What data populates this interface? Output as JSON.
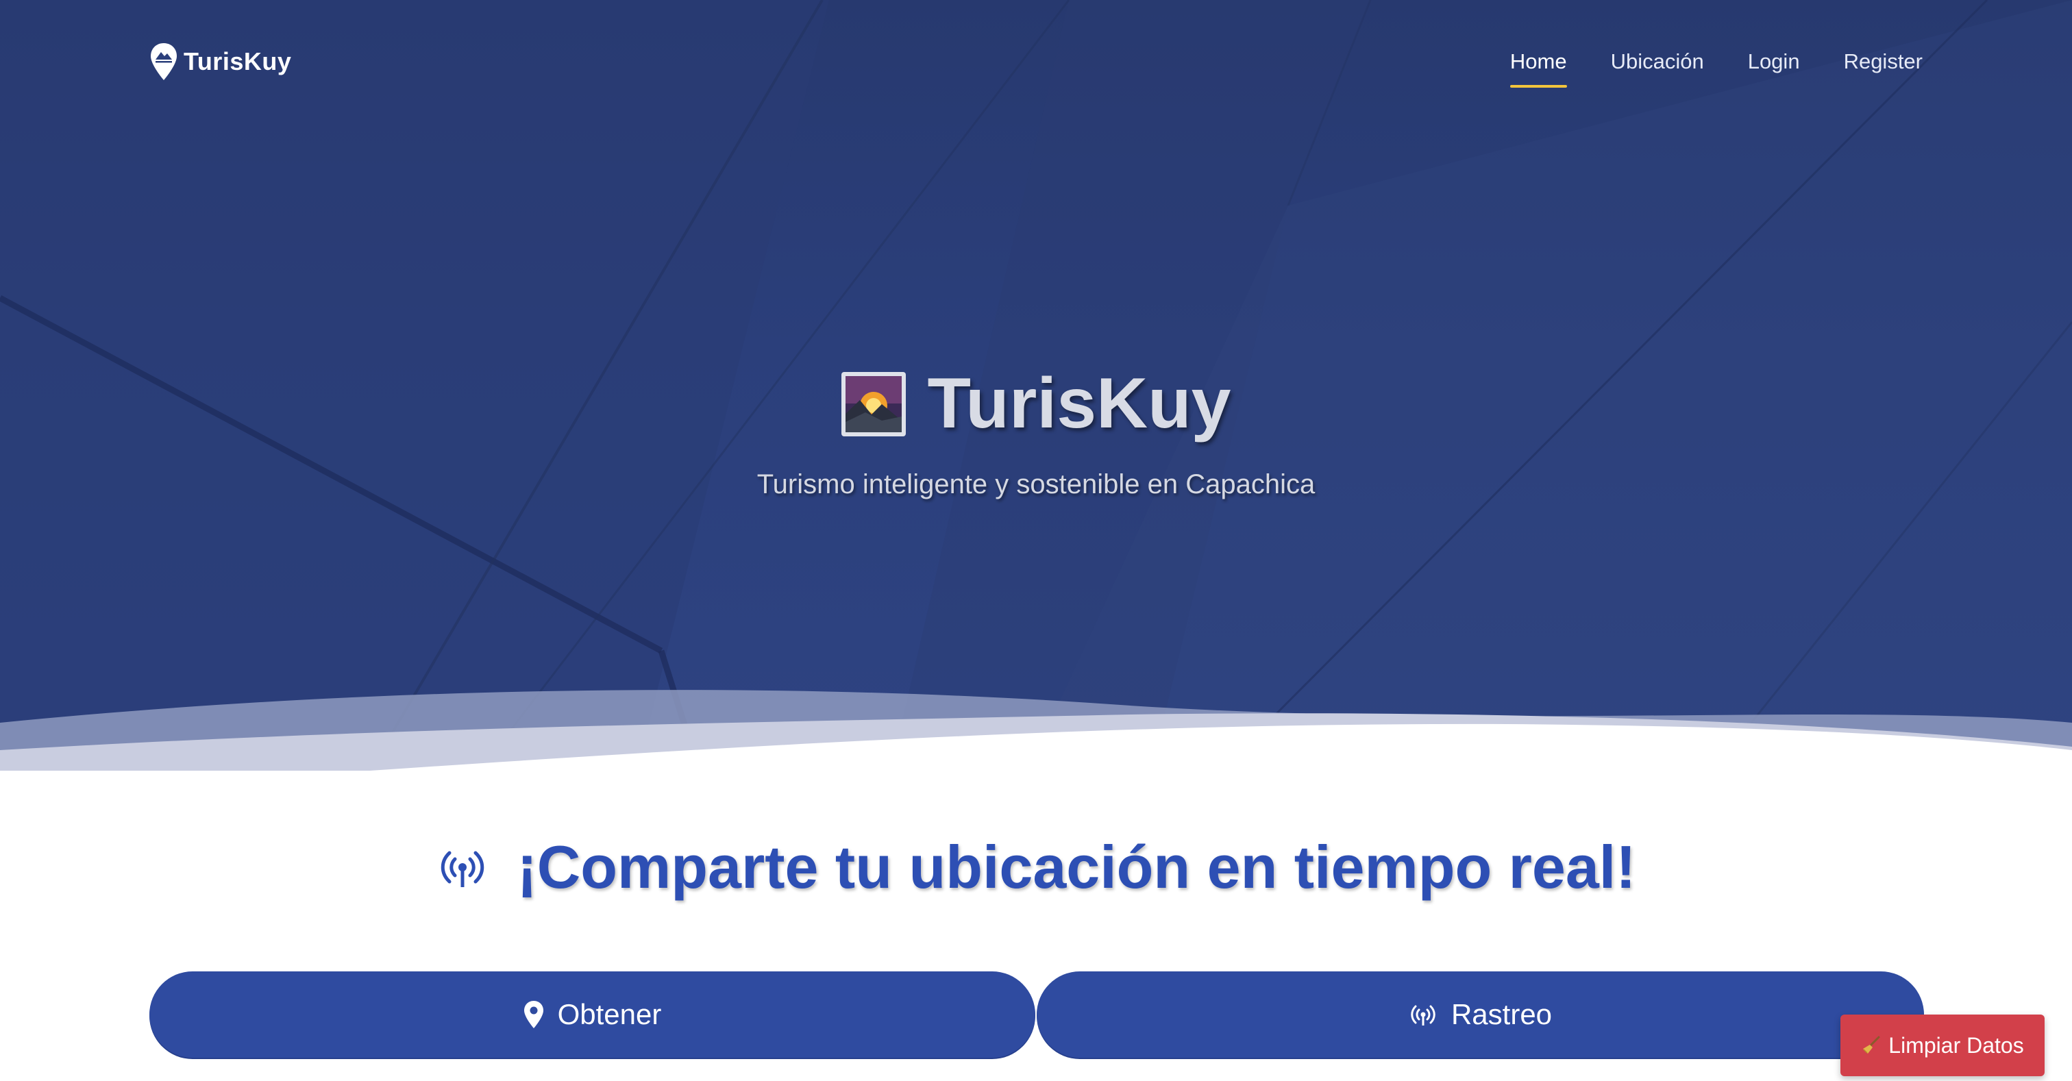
{
  "colors": {
    "hero_bg": "#2b3f7b",
    "nav_active_underline": "#f2c43c",
    "primary_button": "#2f4ba0",
    "heading_blue": "#2d4fb4",
    "danger_button": "#d2404a"
  },
  "navbar": {
    "brand": {
      "text": "TurisKuy",
      "icon": "location-pin-mountain-icon"
    },
    "links": [
      {
        "label": "Home",
        "active": true
      },
      {
        "label": "Ubicación",
        "active": false
      },
      {
        "label": "Login",
        "active": false
      },
      {
        "label": "Register",
        "active": false
      }
    ]
  },
  "hero": {
    "title": "TurisKuy",
    "title_icon": "sunrise-over-mountains-icon",
    "subtitle": "Turismo inteligente y sostenible en Capachica"
  },
  "share": {
    "heading": "¡Comparte tu ubicación en tiempo real!",
    "heading_icon": "broadcast-icon",
    "buttons": {
      "obtener": {
        "label": "Obtener",
        "icon": "map-pin-icon"
      },
      "rastreo": {
        "label": "Rastreo",
        "icon": "broadcast-icon"
      }
    }
  },
  "floating": {
    "clear_data": {
      "label": "Limpiar Datos",
      "icon": "broom-icon"
    }
  }
}
